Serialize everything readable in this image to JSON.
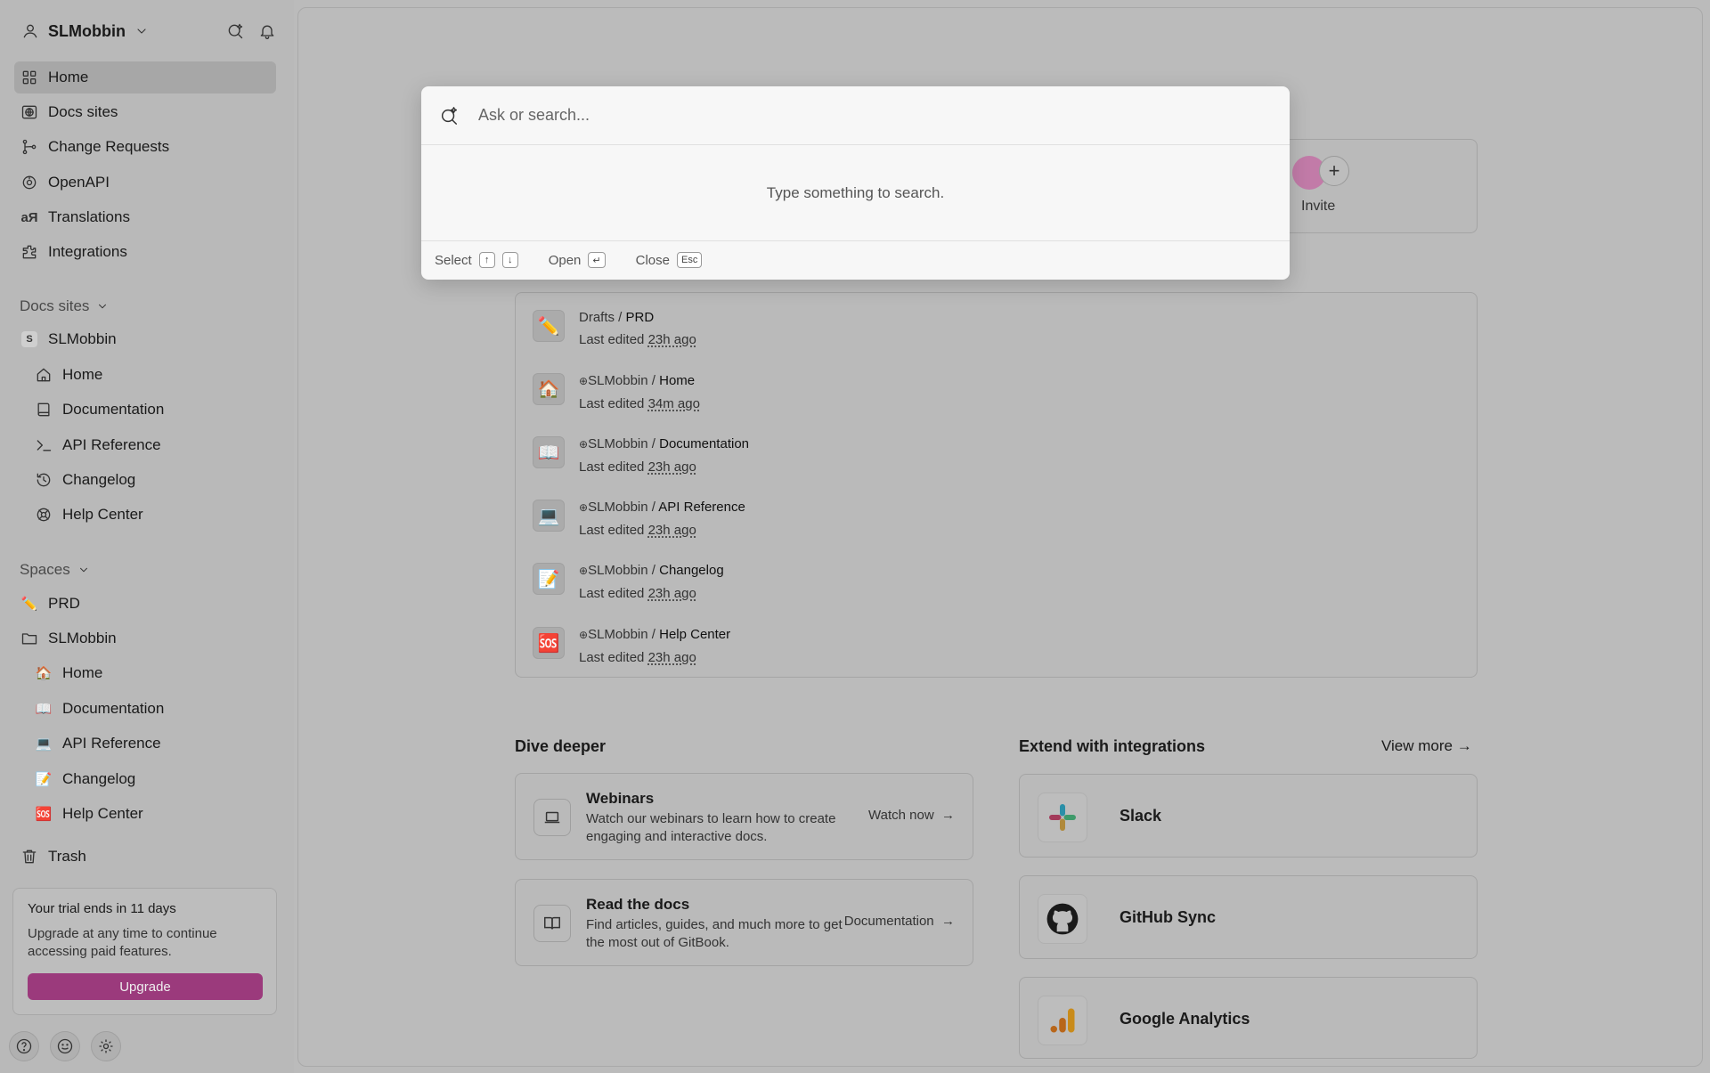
{
  "workspace": {
    "name": "SLMobbin"
  },
  "nav": [
    {
      "label": "Home",
      "icon": "grid-icon"
    },
    {
      "label": "Docs sites",
      "icon": "globe-icon"
    },
    {
      "label": "Change Requests",
      "icon": "branch-icon"
    },
    {
      "label": "OpenAPI",
      "icon": "openapi-icon"
    },
    {
      "label": "Translations",
      "icon": "translate-icon"
    },
    {
      "label": "Integrations",
      "icon": "puzzle-icon"
    }
  ],
  "docs_sites": {
    "label": "Docs sites",
    "site": {
      "badge": "S",
      "name": "SLMobbin"
    },
    "items": [
      "Home",
      "Documentation",
      "API Reference",
      "Changelog",
      "Help Center"
    ]
  },
  "spaces": {
    "label": "Spaces",
    "prd": "PRD",
    "collection": "SLMobbin",
    "items": [
      "Home",
      "Documentation",
      "API Reference",
      "Changelog",
      "Help Center"
    ]
  },
  "trash": "Trash",
  "trial": {
    "title": "Your trial ends in 11 days",
    "body": "Upgrade at any time to continue accessing paid features.",
    "button": "Upgrade"
  },
  "invite": {
    "label": "Invite"
  },
  "recent": [
    {
      "prefix": "Drafts / ",
      "page": "PRD",
      "edited": "Last edited ",
      "time": "23h ago",
      "icon": "✏️",
      "globe": false
    },
    {
      "prefix": "SLMobbin / ",
      "page": "Home",
      "edited": "Last edited ",
      "time": "34m ago",
      "icon": "🏠",
      "globe": true
    },
    {
      "prefix": "SLMobbin / ",
      "page": "Documentation",
      "edited": "Last edited ",
      "time": "23h ago",
      "icon": "📖",
      "globe": true
    },
    {
      "prefix": "SLMobbin / ",
      "page": "API Reference",
      "edited": "Last edited ",
      "time": "23h ago",
      "icon": "💻",
      "globe": true
    },
    {
      "prefix": "SLMobbin / ",
      "page": "Changelog",
      "edited": "Last edited ",
      "time": "23h ago",
      "icon": "📝",
      "globe": true
    },
    {
      "prefix": "SLMobbin / ",
      "page": "Help Center",
      "edited": "Last edited ",
      "time": "23h ago",
      "icon": "🆘",
      "globe": true
    }
  ],
  "dive": {
    "title": "Dive deeper",
    "cards": [
      {
        "title": "Webinars",
        "desc": "Watch our webinars to learn how to create engaging and interactive docs.",
        "action": "Watch now"
      },
      {
        "title": "Read the docs",
        "desc": "Find articles, guides, and much more to get the most out of GitBook.",
        "action": "Documentation"
      }
    ]
  },
  "integrations": {
    "title": "Extend with integrations",
    "view_more": "View more",
    "items": [
      {
        "name": "Slack"
      },
      {
        "name": "GitHub Sync"
      },
      {
        "name": "Google Analytics"
      }
    ]
  },
  "search": {
    "placeholder": "Ask or search...",
    "empty": "Type something to search.",
    "footer": {
      "select": "Select",
      "up_key": "↑",
      "down_key": "↓",
      "open": "Open",
      "enter_key": "↵",
      "close": "Close",
      "esc_key": "Esc"
    }
  },
  "colors": {
    "upgrade": "#9b3a7c",
    "modal_bg": "#f7f7f7",
    "overlay": "#bbbbbb"
  }
}
